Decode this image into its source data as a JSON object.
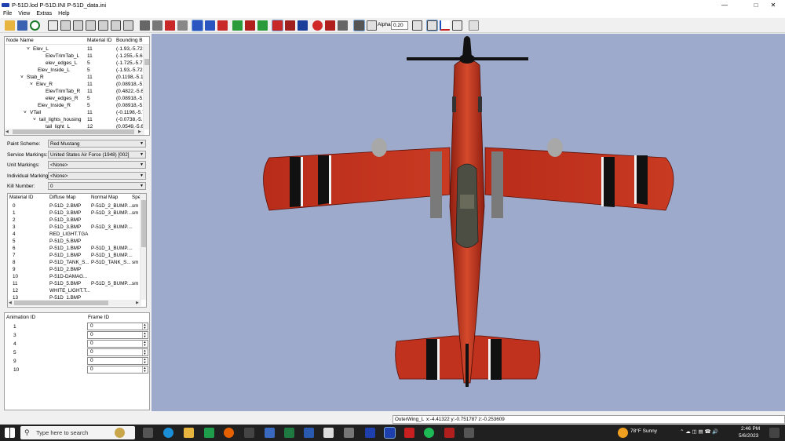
{
  "window": {
    "title": "P-51D.lod  P-51D.INI  P-51D_data.ini",
    "min_symbol": "—",
    "max_symbol": "□",
    "close_symbol": "✕"
  },
  "menu": [
    "File",
    "View",
    "Extras",
    "Help"
  ],
  "toolbar": {
    "alpha_label": "Alpha:",
    "alpha_value": "0.20"
  },
  "tree": {
    "headers": [
      "Node Name",
      "Material ID",
      "Bounding B"
    ],
    "rows": [
      {
        "name": "Elev_L",
        "mat": "11",
        "bb": "(-1.93,-5.728",
        "chev": "˅"
      },
      {
        "name": "ElevTrimTab_L",
        "mat": "11",
        "bb": "(-1.255,-5.68",
        "chev": ""
      },
      {
        "name": "elev_edges_L",
        "mat": "5",
        "bb": "(-1.725,-5.72",
        "chev": ""
      },
      {
        "name": "Elev_Inside_L",
        "mat": "5",
        "bb": "(-1.93,-5.728",
        "chev": ""
      },
      {
        "name": "Stab_R",
        "mat": "11",
        "bb": "(0.1198,-5.14",
        "chev": "˅"
      },
      {
        "name": "Elev_R",
        "mat": "11",
        "bb": "(0.08918,-5.7",
        "chev": "˅"
      },
      {
        "name": "ElevTrimTab_R",
        "mat": "11",
        "bb": "(0.4822,-5.68",
        "chev": ""
      },
      {
        "name": "elev_edges_R",
        "mat": "5",
        "bb": "(0.08918,-5.7",
        "chev": ""
      },
      {
        "name": "Elev_Inside_R",
        "mat": "5",
        "bb": "(0.08918,-5.7",
        "chev": ""
      },
      {
        "name": "VTail",
        "mat": "11",
        "bb": "(-0.1198,-5.7",
        "chev": "˅"
      },
      {
        "name": "tail_lights_housing",
        "mat": "11",
        "bb": "(-0.0738,-5.6",
        "chev": "˅"
      },
      {
        "name": "tail_light_L",
        "mat": "12",
        "bb": "(0.0549,-5.62",
        "chev": ""
      }
    ]
  },
  "form": [
    {
      "label": "Paint Scheme:",
      "value": "Red Mustang"
    },
    {
      "label": "Service Markings:",
      "value": "United States Air Force (1948) [002]"
    },
    {
      "label": "Unit Markings:",
      "value": "<None>"
    },
    {
      "label": "Individual Markings:",
      "value": "<None>"
    },
    {
      "label": "Kill Number:",
      "value": "0"
    }
  ],
  "materials": {
    "headers": [
      "Material ID",
      "Diffuse Map",
      "Normal Map",
      "Spe"
    ],
    "rows": [
      [
        "0",
        "P-51D_2.BMP",
        "P-51D_2_BUMP....",
        "sm"
      ],
      [
        "1",
        "P-51D_3.BMP",
        "P-51D_3_BUMP....",
        "sm"
      ],
      [
        "2",
        "P-51D_3.BMP",
        "",
        ""
      ],
      [
        "3",
        "P-51D_3.BMP",
        "P-51D_3_BUMP....",
        ""
      ],
      [
        "4",
        "RED_LIGHT.TGA",
        "",
        ""
      ],
      [
        "5",
        "P-51D_5.BMP",
        "",
        ""
      ],
      [
        "6",
        "P-51D_1.BMP",
        "P-51D_1_BUMP....",
        ""
      ],
      [
        "7",
        "P-51D_1.BMP",
        "P-51D_1_BUMP....",
        ""
      ],
      [
        "8",
        "P-51D_TANK_S...",
        "P-51D_TANK_S...",
        "sm"
      ],
      [
        "9",
        "P-51D_2.BMP",
        "",
        ""
      ],
      [
        "10",
        "P-51D-DAMAG...",
        "",
        ""
      ],
      [
        "11",
        "P-51D_5.BMP",
        "P-51D_5_BUMP....",
        "sm"
      ],
      [
        "12",
        "WHITE_LIGHT.T...",
        "",
        ""
      ],
      [
        "13",
        "P-51D_1.BMP",
        "",
        ""
      ]
    ]
  },
  "animation": {
    "headers": [
      "Animation ID",
      "Frame ID"
    ],
    "rows": [
      {
        "id": "1",
        "frame": "0"
      },
      {
        "id": "3",
        "frame": "0"
      },
      {
        "id": "4",
        "frame": "0"
      },
      {
        "id": "5",
        "frame": "0"
      },
      {
        "id": "9",
        "frame": "0"
      },
      {
        "id": "10",
        "frame": "0"
      }
    ]
  },
  "status": {
    "node": "OuterWing_L",
    "coords": "x:-4.41322 y:-0.751787 z:-0.253609"
  },
  "taskbar": {
    "search_placeholder": "Type here to search",
    "weather": "78°F  Sunny",
    "time": "2:46 PM",
    "date": "5/6/2023"
  },
  "colors": {
    "viewport": "#9eaacb",
    "aircraft_red": "#c1321e",
    "taskbar": "#202020"
  }
}
